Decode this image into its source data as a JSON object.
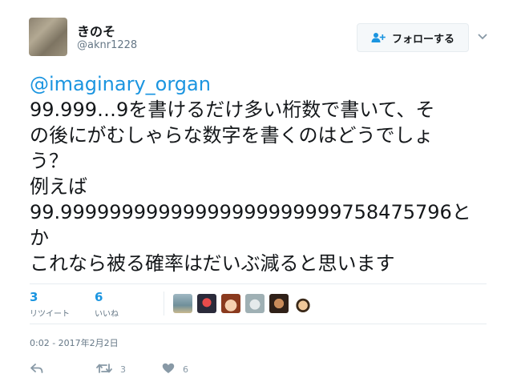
{
  "tweet": {
    "user": {
      "display_name": "きのそ",
      "handle": "@aknr1228"
    },
    "follow_button_label": "フォローする",
    "mention": "@imaginary_organ",
    "text_lines": [
      "99.999…9を書けるだけ多い桁数で書いて、そ",
      "の後にがむしゃらな数字を書くのはどうでしょ",
      "う？",
      "例えば",
      "99.99999999999999999999999758475796と",
      "か",
      "これなら被る確率はだいぶ減ると思います"
    ],
    "stats": {
      "retweets": {
        "count": "3",
        "label": "リツイート"
      },
      "likes": {
        "count": "6",
        "label": "いいね"
      }
    },
    "likers": [
      {
        "name": "liker-1",
        "color": "#6f8f9a"
      },
      {
        "name": "liker-2",
        "color": "#2a2a3a"
      },
      {
        "name": "liker-3",
        "color": "#d98e6c"
      },
      {
        "name": "liker-4",
        "color": "#9fb0b4"
      },
      {
        "name": "liker-5",
        "color": "#5a3c2c"
      },
      {
        "name": "liker-6",
        "color": "#f2f2f2"
      }
    ],
    "timestamp": "0:02 - 2017年2月2日",
    "actions": {
      "reply_icon": "reply-icon",
      "retweet_icon": "retweet-icon",
      "retweet_count": "3",
      "like_icon": "heart-icon",
      "like_count": "6"
    },
    "colors": {
      "link": "#1b95e0",
      "muted": "#657786",
      "action": "#8899a6"
    }
  }
}
